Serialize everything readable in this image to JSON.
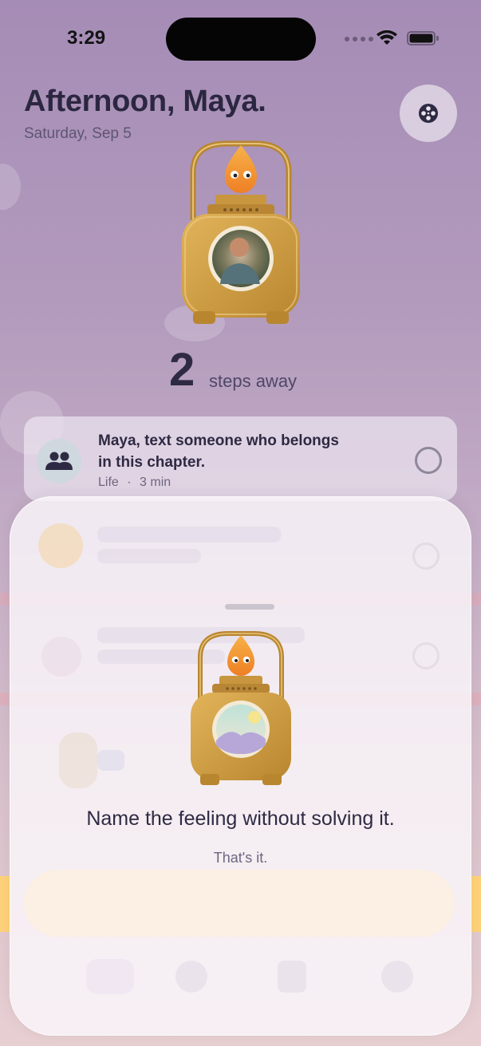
{
  "status_bar": {
    "time": "3:29"
  },
  "header": {
    "greeting": "Afternoon, Maya.",
    "date": "Saturday, Sep 5"
  },
  "icons": {
    "settings": "film-reel-icon",
    "wifi": "wifi-icon",
    "battery": "battery-icon",
    "people": "people-icon"
  },
  "hero": {
    "steps_number": "2",
    "steps_label": "steps away"
  },
  "task": {
    "title": "Maya, text someone who belongs in this chapter.",
    "category": "Life",
    "separator": "·",
    "duration": "3 min"
  },
  "sheet": {
    "prompt": "Name the feeling without solving it.",
    "subtitle": "That's it."
  },
  "colors": {
    "background_top": "#a58cb6",
    "accent_gold": "#c89a3e",
    "flame_orange": "#f29a2e",
    "text_dark": "#2e2a43"
  }
}
